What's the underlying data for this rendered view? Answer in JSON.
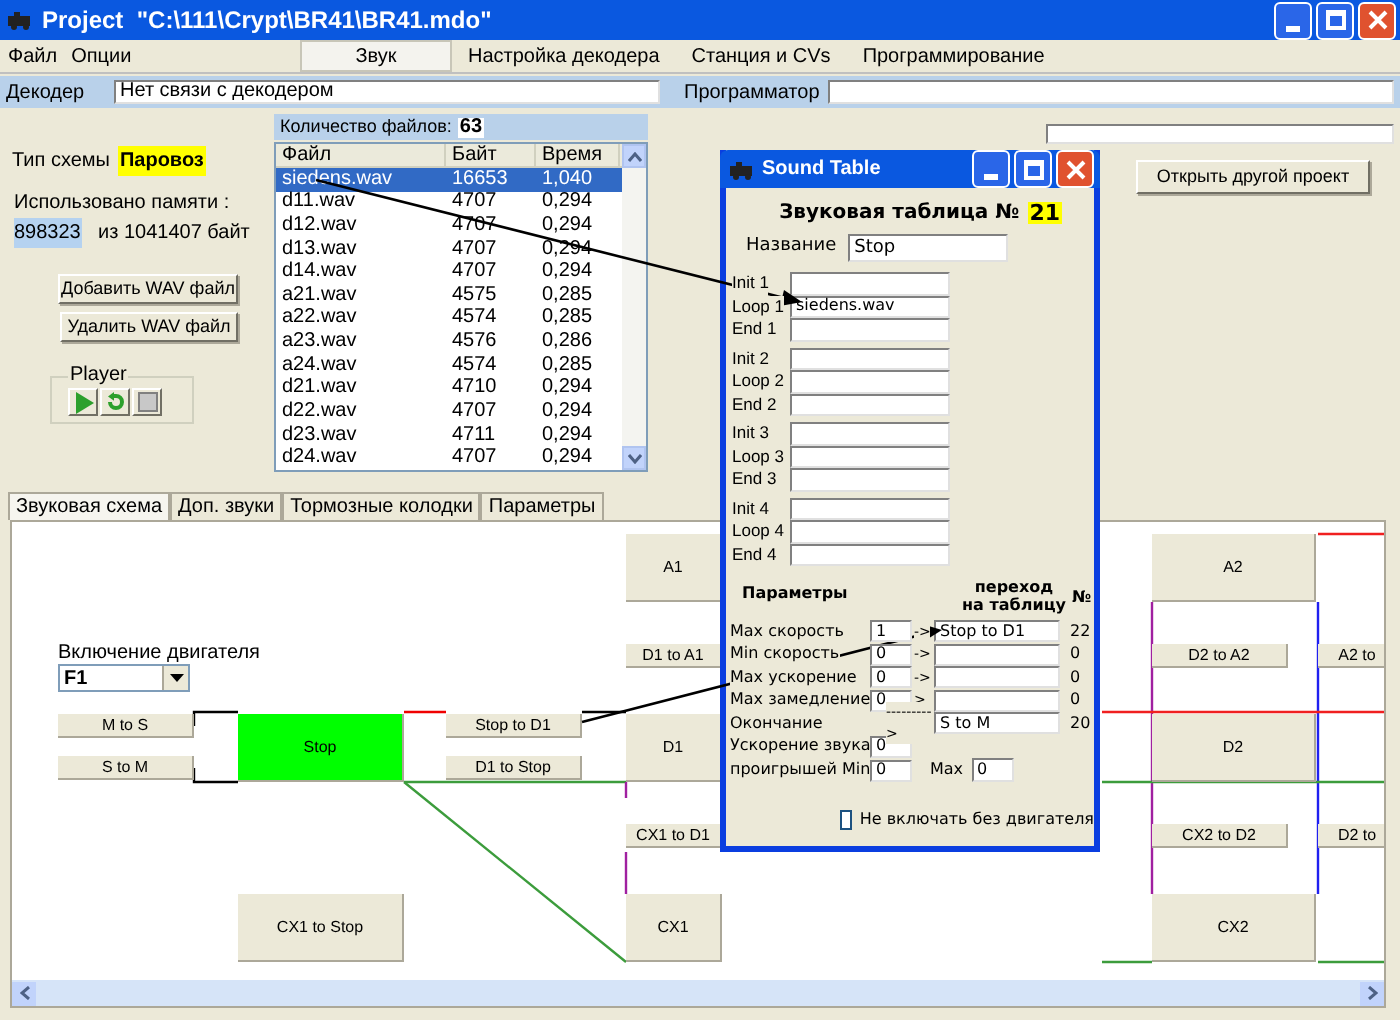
{
  "window": {
    "title": "Project  \"C:\\111\\Crypt\\BR41\\BR41.mdo\""
  },
  "menu": [
    "Файл",
    "Опции"
  ],
  "tabs": [
    {
      "label": "Звук",
      "selected": true
    },
    {
      "label": "Настройка декодера",
      "selected": false
    },
    {
      "label": "Станция и CVs",
      "selected": false
    },
    {
      "label": "Программирование",
      "selected": false
    }
  ],
  "decoder": {
    "label": "Декодер",
    "value": "Нет связи с декодером"
  },
  "programmer": {
    "label": "Программатор"
  },
  "scheme_type": {
    "label": "Тип схемы",
    "value": "Паровоз"
  },
  "memory": {
    "label": "Использовано памяти :",
    "used": "898323",
    "total": "из 1041407 байт"
  },
  "buttons": [
    "Добавить WAV файл",
    "Удалить WAV файл"
  ],
  "player": {
    "label": "Player"
  },
  "files": {
    "count_label": "Количество файлов:",
    "count": "63",
    "columns": [
      "Файл",
      "Байт",
      "Время"
    ],
    "rows": [
      {
        "cells": [
          "siedens.wav",
          "16653",
          "1,040"
        ],
        "selected": true
      },
      {
        "cells": [
          "d11.wav",
          "4707",
          "0,294"
        ],
        "selected": false
      },
      {
        "cells": [
          "d12.wav",
          "4707",
          "0,294"
        ],
        "selected": false
      },
      {
        "cells": [
          "d13.wav",
          "4707",
          "0,294"
        ],
        "selected": false
      },
      {
        "cells": [
          "d14.wav",
          "4707",
          "0,294"
        ],
        "selected": false
      },
      {
        "cells": [
          "a21.wav",
          "4575",
          "0,285"
        ],
        "selected": false
      },
      {
        "cells": [
          "a22.wav",
          "4574",
          "0,285"
        ],
        "selected": false
      },
      {
        "cells": [
          "a23.wav",
          "4576",
          "0,286"
        ],
        "selected": false
      },
      {
        "cells": [
          "a24.wav",
          "4574",
          "0,285"
        ],
        "selected": false
      },
      {
        "cells": [
          "d21.wav",
          "4710",
          "0,294"
        ],
        "selected": false
      },
      {
        "cells": [
          "d22.wav",
          "4707",
          "0,294"
        ],
        "selected": false
      },
      {
        "cells": [
          "d23.wav",
          "4711",
          "0,294"
        ],
        "selected": false
      },
      {
        "cells": [
          "d24.wav",
          "4707",
          "0,294"
        ],
        "selected": false
      }
    ]
  },
  "open_project_button": "Открыть другой проект",
  "bottom_tabs": [
    {
      "label": "Звуковая схема",
      "selected": true
    },
    {
      "label": "Доп. звуки",
      "selected": false
    },
    {
      "label": "Тормозные колодки",
      "selected": false
    },
    {
      "label": "Параметры",
      "selected": false
    }
  ],
  "diagram": {
    "engine_label": "Включение двигателя",
    "engine_select": "F1",
    "nodes": [
      {
        "label": "A1",
        "selected": false
      },
      {
        "label": "D1 to A1",
        "selected": false
      },
      {
        "label": "D1",
        "selected": false
      },
      {
        "label": "CX1 to D1",
        "selected": false
      },
      {
        "label": "CX1",
        "selected": false
      },
      {
        "label": "M to S",
        "selected": false
      },
      {
        "label": "S to M",
        "selected": false
      },
      {
        "label": "Stop",
        "selected": true
      },
      {
        "label": "Stop to D1",
        "selected": false
      },
      {
        "label": "D1 to Stop",
        "selected": false
      },
      {
        "label": "CX1 to Stop",
        "selected": false
      },
      {
        "label": "A2",
        "selected": false
      },
      {
        "label": "D2 to A2",
        "selected": false
      },
      {
        "label": "D2",
        "selected": false
      },
      {
        "label": "CX2 to D2",
        "selected": false
      },
      {
        "label": "CX2",
        "selected": false
      },
      {
        "label": "A2 to",
        "selected": false
      },
      {
        "label": "D2 to",
        "selected": false
      }
    ]
  },
  "sound_table": {
    "title": "Sound Table",
    "heading": "Звуковая таблица №",
    "number": "21",
    "name_label": "Название",
    "name": "Stop",
    "groups": [
      [
        {
          "label": "Init 1"
        },
        {
          "label": "Loop 1",
          "value": "siedens.wav"
        },
        {
          "label": "End 1"
        }
      ],
      [
        {
          "label": "Init 2"
        },
        {
          "label": "Loop 2"
        },
        {
          "label": "End 2"
        }
      ],
      [
        {
          "label": "Init 3"
        },
        {
          "label": "Loop 3"
        },
        {
          "label": "End 3"
        }
      ],
      [
        {
          "label": "Init 4"
        },
        {
          "label": "Loop 4"
        },
        {
          "label": "End 4"
        }
      ]
    ],
    "params_header": "Параметры",
    "transition_header": [
      "переход",
      "на таблицу"
    ],
    "number_header": "№",
    "params": [
      {
        "kind": "field",
        "label": "Max скорость",
        "value": "1",
        "arrow": "->",
        "target": "Stop to D1",
        "number": "22"
      },
      {
        "kind": "field",
        "label": "Min скорость",
        "value": "0",
        "arrow": "->",
        "number": "0"
      },
      {
        "kind": "field",
        "label": "Max ускорение",
        "value": "0",
        "arrow": "->",
        "number": "0"
      },
      {
        "kind": "field",
        "label": "Max замедление",
        "value": "0",
        "arrow": ">",
        "number": "0"
      },
      {
        "kind": "fixed",
        "label": "Окончание",
        "arrow": "--------->",
        "target": "S to M",
        "number": "20"
      }
    ],
    "acceleration": {
      "label": "Ускорение звука",
      "value": "0"
    },
    "losses": {
      "label": "проигрышей Min",
      "min": "0",
      "max_label": "Max",
      "max": "0"
    },
    "no_engine": {
      "label": "Не включать без двигателя",
      "checked": false
    }
  }
}
